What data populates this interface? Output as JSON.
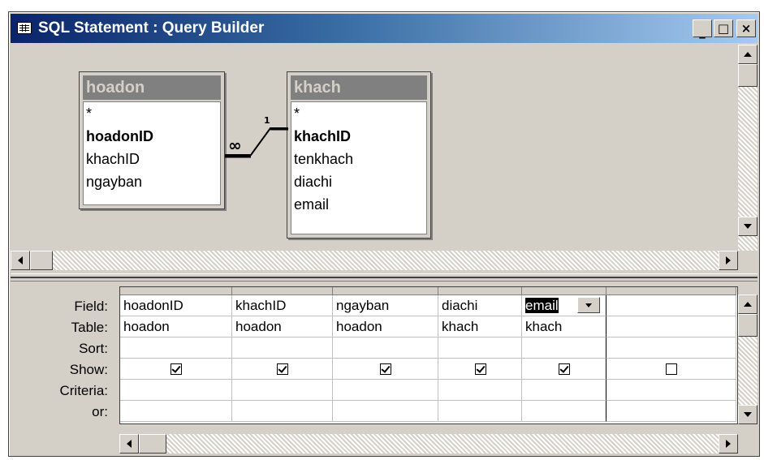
{
  "window": {
    "title": "SQL Statement : Query Builder",
    "controls": {
      "minimize": "_",
      "maximize": "□",
      "close": "×"
    }
  },
  "diagram": {
    "tables": [
      {
        "name": "hoadon",
        "fields": [
          "*",
          "hoadonID",
          "khachID",
          "ngayban"
        ],
        "primary_key": "hoadonID"
      },
      {
        "name": "khach",
        "fields": [
          "*",
          "khachID",
          "tenkhach",
          "diachi",
          "email"
        ],
        "primary_key": "khachID"
      }
    ],
    "join": {
      "many_label": "∞",
      "one_label": "1"
    }
  },
  "grid": {
    "row_labels": [
      "Field:",
      "Table:",
      "Sort:",
      "Show:",
      "Criteria:",
      "or:"
    ],
    "columns": [
      {
        "field": "hoadonID",
        "table": "hoadon",
        "sort": "",
        "show": true,
        "criteria": "",
        "or": ""
      },
      {
        "field": "khachID",
        "table": "hoadon",
        "sort": "",
        "show": true,
        "criteria": "",
        "or": ""
      },
      {
        "field": "ngayban",
        "table": "hoadon",
        "sort": "",
        "show": true,
        "criteria": "",
        "or": ""
      },
      {
        "field": "diachi",
        "table": "khach",
        "sort": "",
        "show": true,
        "criteria": "",
        "or": ""
      },
      {
        "field": "email",
        "table": "khach",
        "sort": "",
        "show": true,
        "criteria": "",
        "or": "",
        "selected": true
      },
      {
        "field": "",
        "table": "",
        "sort": "",
        "show": false,
        "criteria": "",
        "or": ""
      }
    ]
  },
  "colors": {
    "title_gradient_start": "#0a246a",
    "title_gradient_end": "#a6caf0",
    "face": "#d4d0c8",
    "inactive_table_title": "#808080"
  },
  "icons": {
    "window_icon": "query-grid-icon",
    "scroll_up": "arrow-up-icon",
    "scroll_down": "arrow-down-icon",
    "scroll_left": "arrow-left-icon",
    "scroll_right": "arrow-right-icon",
    "dropdown": "chevron-down-icon"
  }
}
